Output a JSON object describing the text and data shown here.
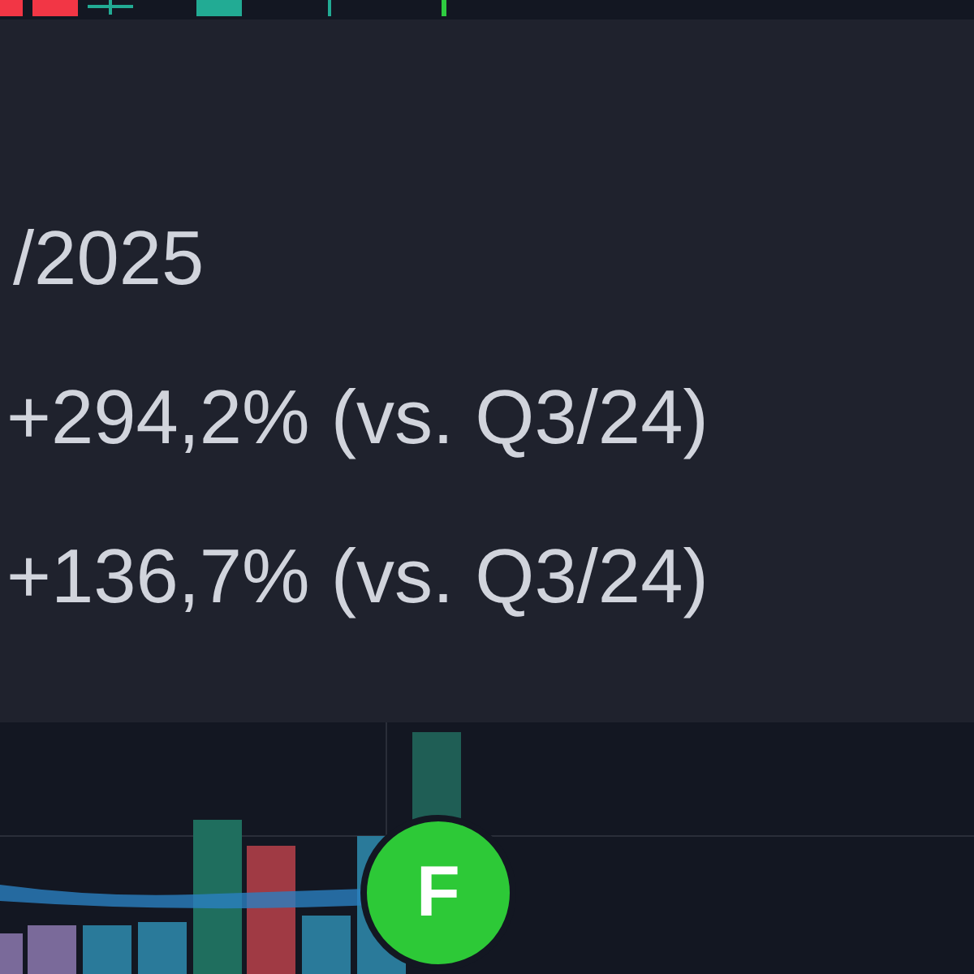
{
  "tooltip": {
    "lines": [
      "/2025",
      "+294,2% (vs. Q3/24)",
      "+136,7% (vs. Q3/24)"
    ]
  },
  "event_marker": {
    "label": "F"
  }
}
